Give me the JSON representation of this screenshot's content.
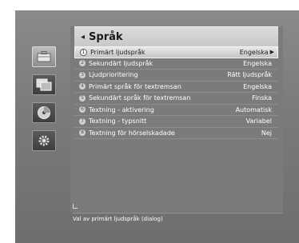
{
  "header": {
    "back_icon": "◂",
    "title": "Språk"
  },
  "side_icons": [
    "briefcase-icon",
    "monitor-icon",
    "disc-icon",
    "gear-icon"
  ],
  "menu": {
    "selected_index": 0,
    "items": [
      {
        "num": "1",
        "label": "Primärt ljudspråk",
        "value": "Engelska"
      },
      {
        "num": "2",
        "label": "Sekundärt ljudspråk",
        "value": "Engelska"
      },
      {
        "num": "3",
        "label": "Ljudprioritering",
        "value": "Rätt ljudspråk"
      },
      {
        "num": "4",
        "label": "Primärt språk för textremsan",
        "value": "Engelska"
      },
      {
        "num": "5",
        "label": "Sekundärt språk för textremsan",
        "value": "Finska"
      },
      {
        "num": "6",
        "label": "Textning - aktivering",
        "value": "Automatisk"
      },
      {
        "num": "7",
        "label": "Textning - typsnitt",
        "value": "Variabel"
      },
      {
        "num": "8",
        "label": "Textning för hörselskadade",
        "value": "Nej"
      }
    ],
    "arrow": "▶"
  },
  "help_text": "Val av primärt ljudspråk (dialog)",
  "colors": {
    "background": "#7b7b7b",
    "selected": "#d8d8d8"
  }
}
